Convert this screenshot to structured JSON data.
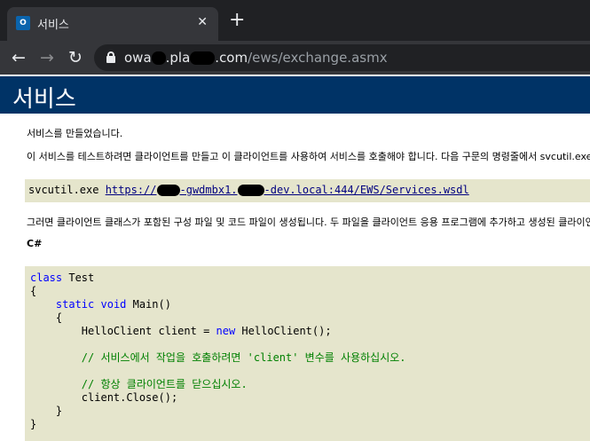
{
  "browser": {
    "tab_title": "서비스",
    "tab_close": "✕",
    "new_tab": "+",
    "favicon_label": "O",
    "nav_back": "←",
    "nav_forward": "→",
    "nav_reload": "↻",
    "url_part1": "owa",
    "url_part2": ".pla",
    "url_part3": ".com",
    "url_path": "/ews/exchange.asmx"
  },
  "page": {
    "title": "서비스",
    "p1": "서비스를 만들었습니다.",
    "p2": "이 서비스를 테스트하려면 클라이언트를 만들고 이 클라이언트를 사용하여 서비스를 호출해야 합니다. 다음 구문의 명령줄에서 svcutil.exe 도구를 사용하여 이 작업을 수행할 수 있습니다.",
    "cmd_prefix": "svcutil.exe ",
    "cmd_link_a": "https://",
    "cmd_link_b": "-gwdmbx1.",
    "cmd_link_c": "-dev.local:444/EWS/Services.wsdl",
    "p3": "그러면 클라이언트 클래스가 포함된 구성 파일 및 코드 파일이 생성됩니다. 두 파일을 클라이언트 응용 프로그램에 추가하고 생성된 클라이언트 클래스를 사용하여 서비스를 호출하십시오.",
    "lang": "C#",
    "code": {
      "l1_kw": "class",
      "l1_rest": " Test",
      "l2": "{",
      "l3_indent": "    ",
      "l3_kw1": "static",
      "l3_sp": " ",
      "l3_kw2": "void",
      "l3_rest": " Main()",
      "l4": "    {",
      "l5_a": "        HelloClient client = ",
      "l5_kw": "new",
      "l5_b": " HelloClient();",
      "l6": "",
      "l7": "        // 서비스에서 작업을 호출하려면 'client' 변수를 사용하십시오.",
      "l8": "",
      "l9": "        // 항상 클라이언트를 닫으십시오.",
      "l10": "        client.Close();",
      "l11": "    }",
      "l12": "}"
    }
  }
}
